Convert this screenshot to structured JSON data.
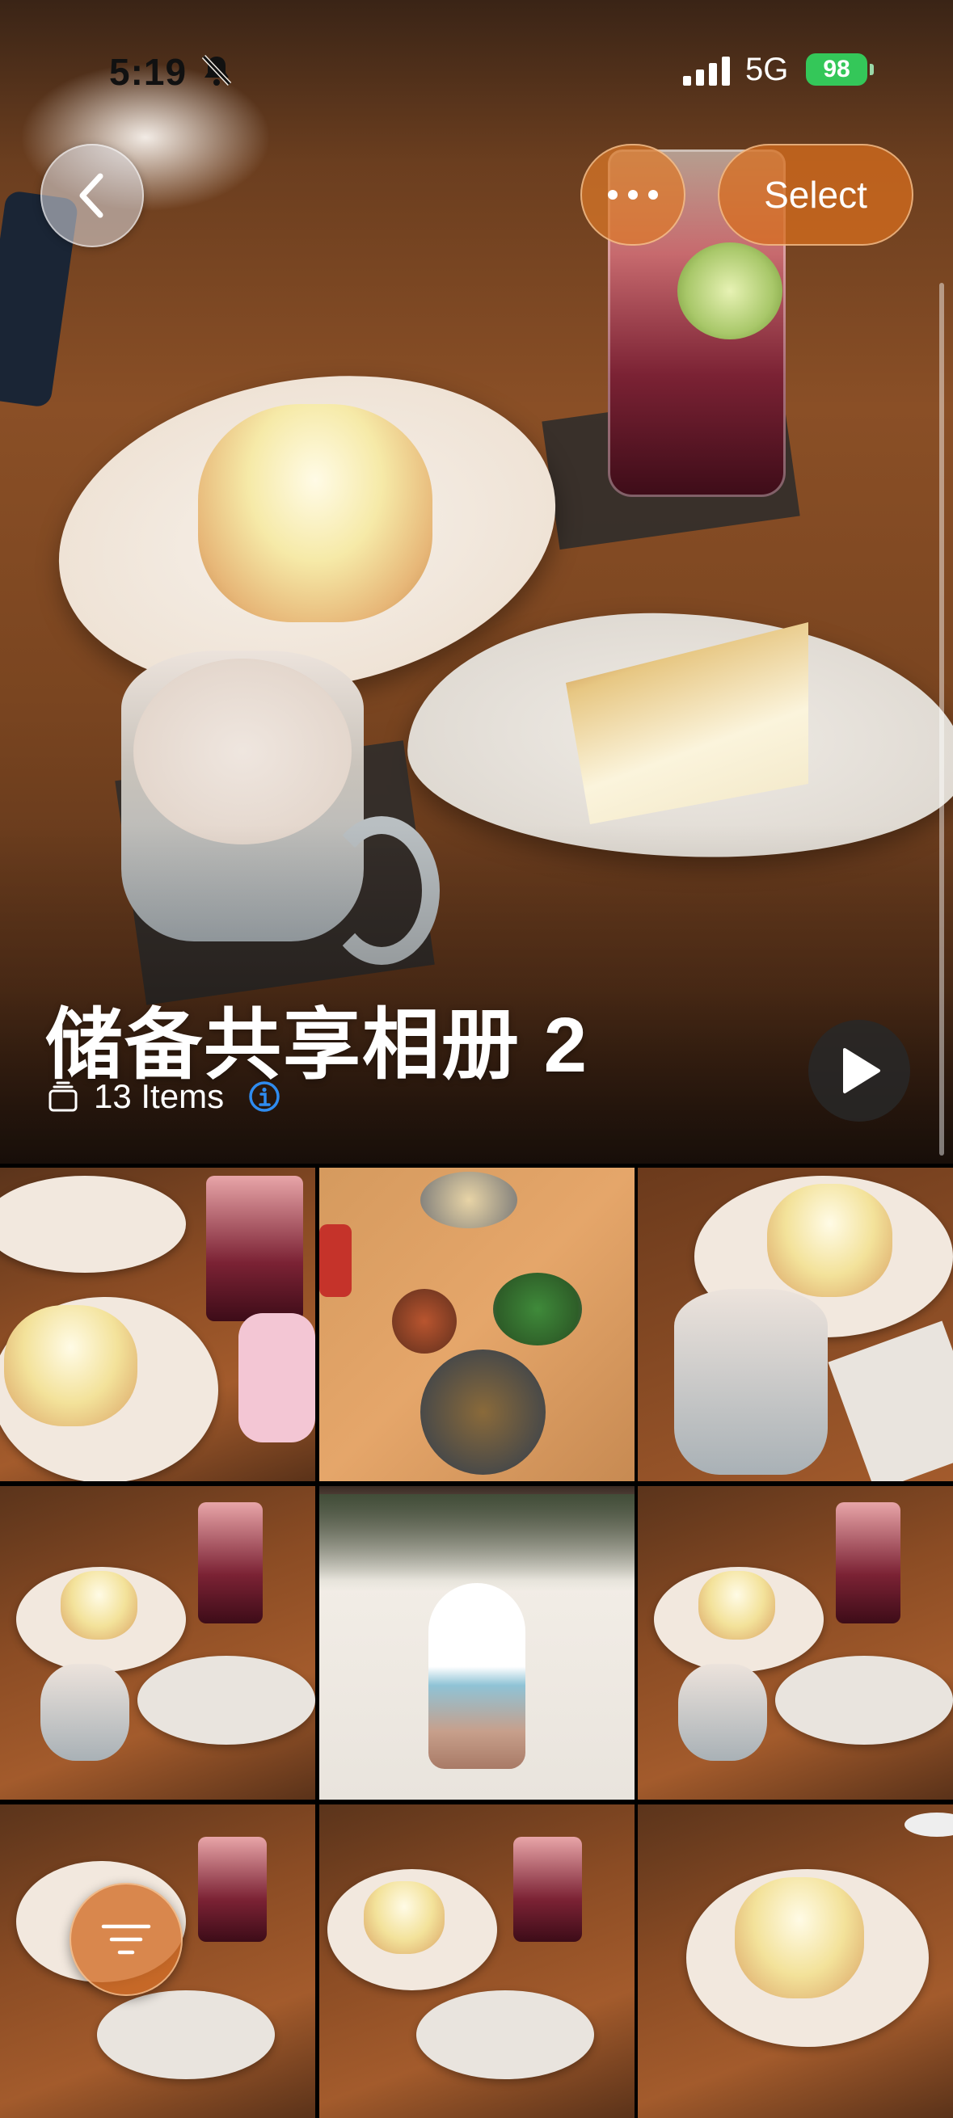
{
  "status_bar": {
    "time": "5:19",
    "network": "5G",
    "battery": "98"
  },
  "toolbar": {
    "back_icon": "chevron-left-icon",
    "more_icon": "ellipsis-icon",
    "select_label": "Select"
  },
  "album": {
    "title": "储备共享相册 2",
    "count_label": "13 Items",
    "stack_icon": "stack-icon",
    "info_icon": "info-icon",
    "play_icon": "play-icon"
  },
  "grid": {
    "thumbnails": [
      "cake-and-drink-photo",
      "vietnamese-food-photo",
      "cake-and-latte-photo",
      "cafe-table-photo",
      "miffy-doll-photo",
      "cafe-table-photo",
      "cafe-table-photo",
      "cafe-table-photo",
      "cake-closeup-photo"
    ]
  },
  "filter_icon": "filter-lines-icon",
  "colors": {
    "accent_orange": "#d86e22",
    "battery_green": "#34c759"
  }
}
